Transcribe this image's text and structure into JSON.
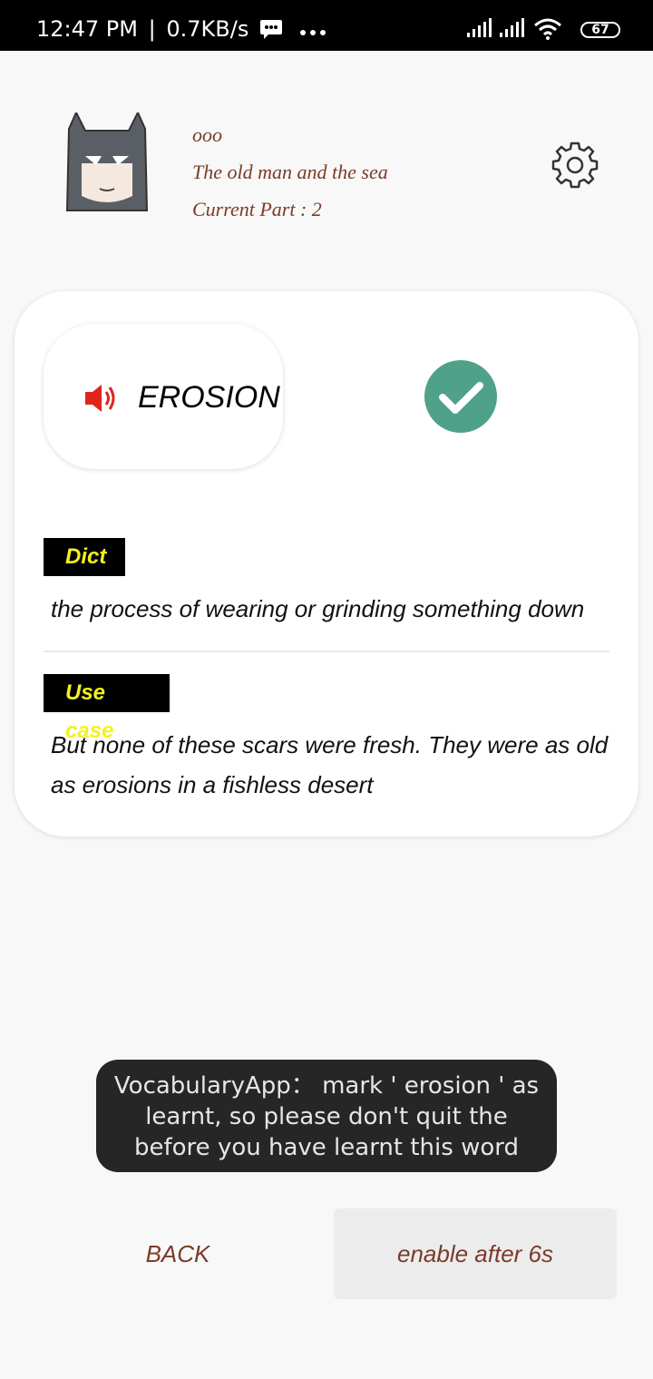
{
  "status_bar": {
    "time": "12:47 PM",
    "speed": "0.7KB/s",
    "battery": "67",
    "icons": [
      "message-icon",
      "more-dots-icon",
      "signal-icon",
      "signal-icon",
      "wifi-icon",
      "battery-icon"
    ]
  },
  "header": {
    "username": "ooo",
    "book_title": "The old man and the sea",
    "current_part": "Current Part : 2",
    "avatar_icon": "batman-avatar",
    "settings_icon": "gear-icon"
  },
  "card": {
    "word": "EROSION",
    "speaker_icon": "speaker-icon",
    "check_icon": "check-icon",
    "dict_label": "Dict",
    "dict_text": "the process of wearing or grinding something down",
    "use_case_label": "Use case",
    "use_case_text": "But none of these scars were fresh. They were as old as erosions in a fishless desert"
  },
  "toast": {
    "message": "VocabularyApp： mark ' erosion ' as learnt, so please don't quit the before you have learnt this word"
  },
  "buttons": {
    "back_label": "BACK",
    "next_label": "enable after 6s"
  },
  "colors": {
    "accent_text": "#7a3b28",
    "check_green": "#4fa18a",
    "tag_bg": "#000000",
    "tag_text": "#f2f21d",
    "speaker_red": "#e0251b"
  }
}
